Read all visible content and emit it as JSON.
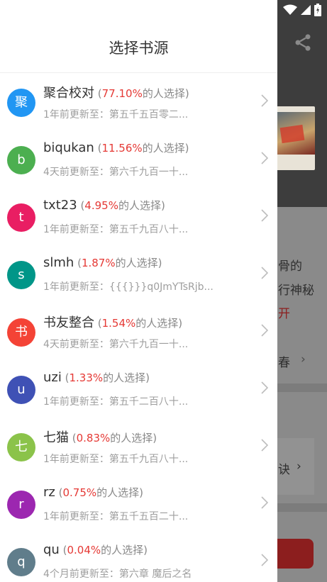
{
  "drawer": {
    "title": "选择书源",
    "sources": [
      {
        "avatar": "聚",
        "color": "#2196f3",
        "name": "聚合校对",
        "percent": "77.10%",
        "suffix": "的人选择)",
        "update": "1年前更新至：第五千五百零二..."
      },
      {
        "avatar": "b",
        "color": "#4caf50",
        "name": "biqukan",
        "percent": "11.56%",
        "suffix": "的人选择)",
        "update": "4天前更新至：第六千九百一十..."
      },
      {
        "avatar": "t",
        "color": "#e91e63",
        "name": "txt23",
        "percent": "4.95%",
        "suffix": "的人选择)",
        "update": "1年前更新至：第五千九百八十..."
      },
      {
        "avatar": "s",
        "color": "#009688",
        "name": "slmh",
        "percent": "1.87%",
        "suffix": "的人选择)",
        "update": "1年前更新至：{{{}}}q0JmYTsRjb..."
      },
      {
        "avatar": "书",
        "color": "#f44336",
        "name": "书友整合",
        "percent": "1.54%",
        "suffix": "的人选择)",
        "update": "4天前更新至：第六千九百一十..."
      },
      {
        "avatar": "u",
        "color": "#3f51b5",
        "name": "uzi",
        "percent": "1.33%",
        "suffix": "的人选择)",
        "update": "1年前更新至：第五千二百八十..."
      },
      {
        "avatar": "七",
        "color": "#8bc34a",
        "name": "七猫",
        "percent": "0.83%",
        "suffix": "的人选择)",
        "update": "1年前更新至：第五千九百八十..."
      },
      {
        "avatar": "r",
        "color": "#9c27b0",
        "name": "rz",
        "percent": "0.75%",
        "suffix": "的人选择)",
        "update": "1年前更新至：第五千五百二十..."
      },
      {
        "avatar": "q",
        "color": "#607d8b",
        "name": "qu",
        "percent": "0.04%",
        "suffix": "的人选择)",
        "update": "4个月前更新至：第六章 魔后之名"
      }
    ]
  },
  "background": {
    "line1": "骨的",
    "line2": "行神秘",
    "line3": "开",
    "line4": "春",
    "line5": "诀",
    "arrow": "›"
  }
}
